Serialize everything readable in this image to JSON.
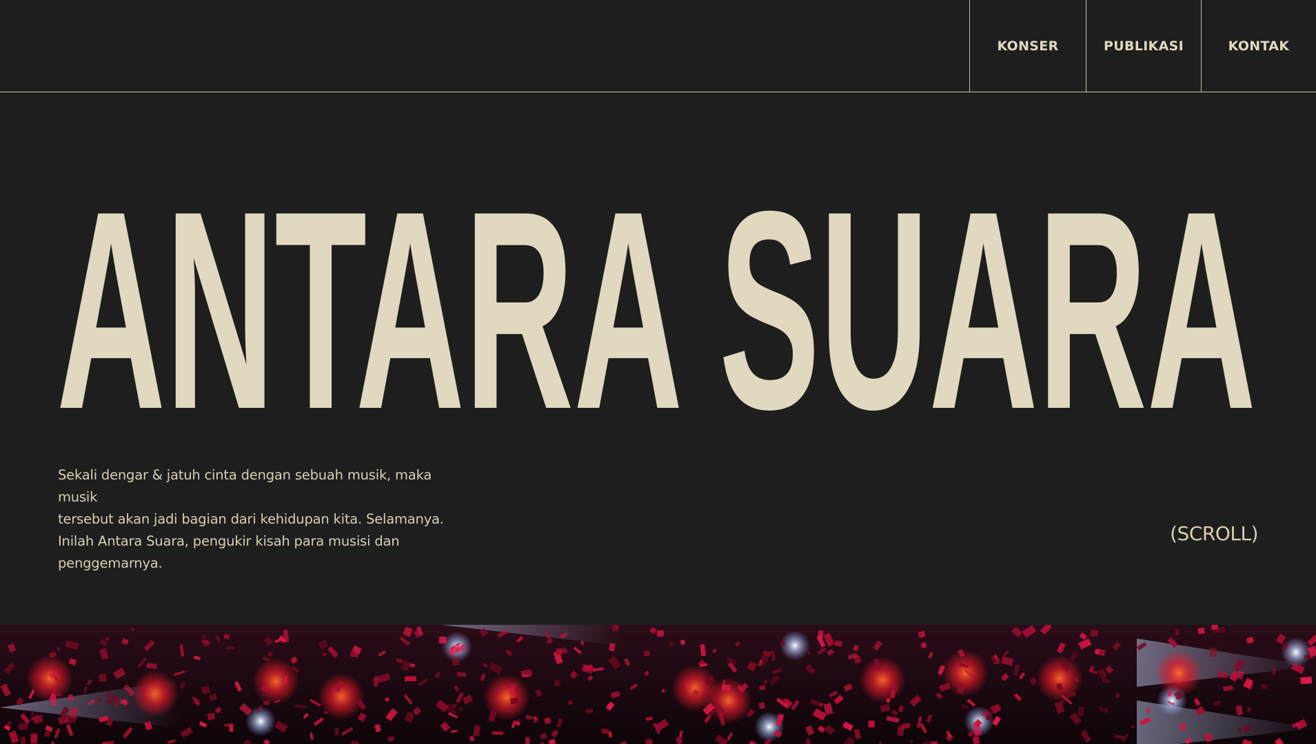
{
  "nav": {
    "items": [
      {
        "label": "KONSER"
      },
      {
        "label": "PUBLIKASI"
      },
      {
        "label": "KONTAK"
      }
    ]
  },
  "hero": {
    "title": "ANTARA SUARA",
    "intro_lines": [
      "Sekali dengar & jatuh cinta dengan sebuah musik, maka musik",
      "tersebut akan jadi bagian dari kehidupan kita. Selamanya.",
      "Inilah Antara Suara, pengukir kisah para musisi dan",
      "penggemarnya."
    ],
    "scroll_hint": "(SCROLL)"
  },
  "colors": {
    "background": "#1e1e1e",
    "text_cream": "#e0d9c0",
    "divider": "#c9c2a8",
    "confetti_red": "#c0103a"
  }
}
